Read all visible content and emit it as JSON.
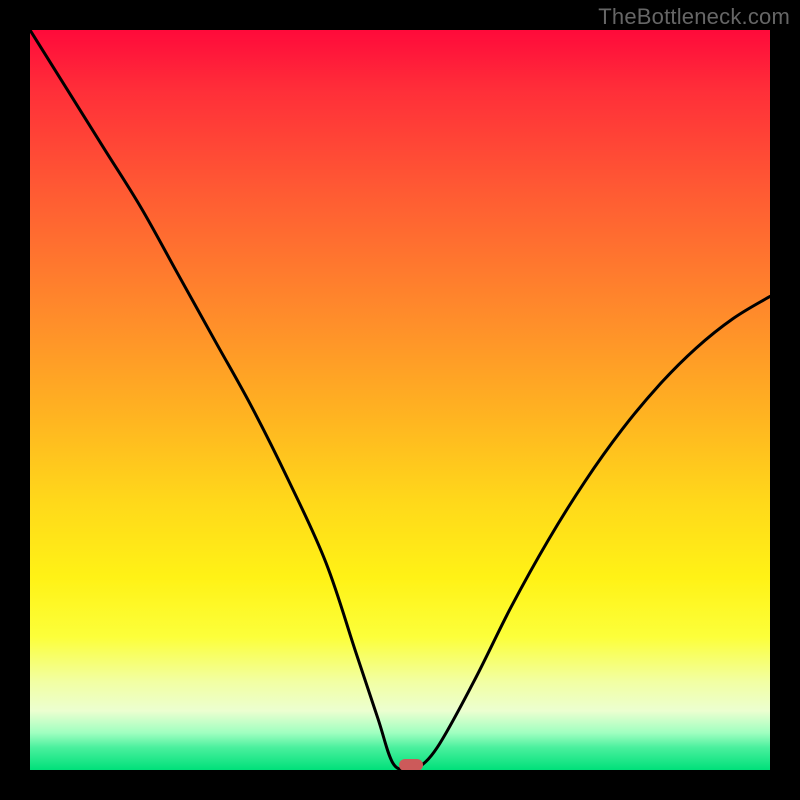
{
  "watermark": "TheBottleneck.com",
  "chart_data": {
    "type": "line",
    "title": "",
    "xlabel": "",
    "ylabel": "",
    "xlim": [
      0,
      100
    ],
    "ylim": [
      0,
      100
    ],
    "grid": false,
    "legend": false,
    "series": [
      {
        "name": "bottleneck-curve",
        "x": [
          0,
          5,
          10,
          15,
          20,
          25,
          30,
          35,
          40,
          44,
          47,
          49,
          51,
          52,
          55,
          60,
          65,
          70,
          75,
          80,
          85,
          90,
          95,
          100
        ],
        "y": [
          100,
          92,
          84,
          76,
          67,
          58,
          49,
          39,
          28,
          16,
          7,
          1,
          0,
          0,
          3,
          12,
          22,
          31,
          39,
          46,
          52,
          57,
          61,
          64
        ]
      }
    ],
    "marker": {
      "x": 51.5,
      "y": 0,
      "color": "#cc5a5a"
    },
    "background_gradient": {
      "stops": [
        {
          "pct": 0,
          "color": "#ff0a3a"
        },
        {
          "pct": 8,
          "color": "#ff2e39"
        },
        {
          "pct": 22,
          "color": "#ff5b33"
        },
        {
          "pct": 38,
          "color": "#ff8a2b"
        },
        {
          "pct": 52,
          "color": "#ffb321"
        },
        {
          "pct": 64,
          "color": "#ffd91a"
        },
        {
          "pct": 74,
          "color": "#fff216"
        },
        {
          "pct": 82,
          "color": "#fcff3a"
        },
        {
          "pct": 88,
          "color": "#f2ffa2"
        },
        {
          "pct": 92,
          "color": "#ecffd0"
        },
        {
          "pct": 95,
          "color": "#9fffc0"
        },
        {
          "pct": 97,
          "color": "#49f09d"
        },
        {
          "pct": 100,
          "color": "#00e07a"
        }
      ]
    }
  }
}
